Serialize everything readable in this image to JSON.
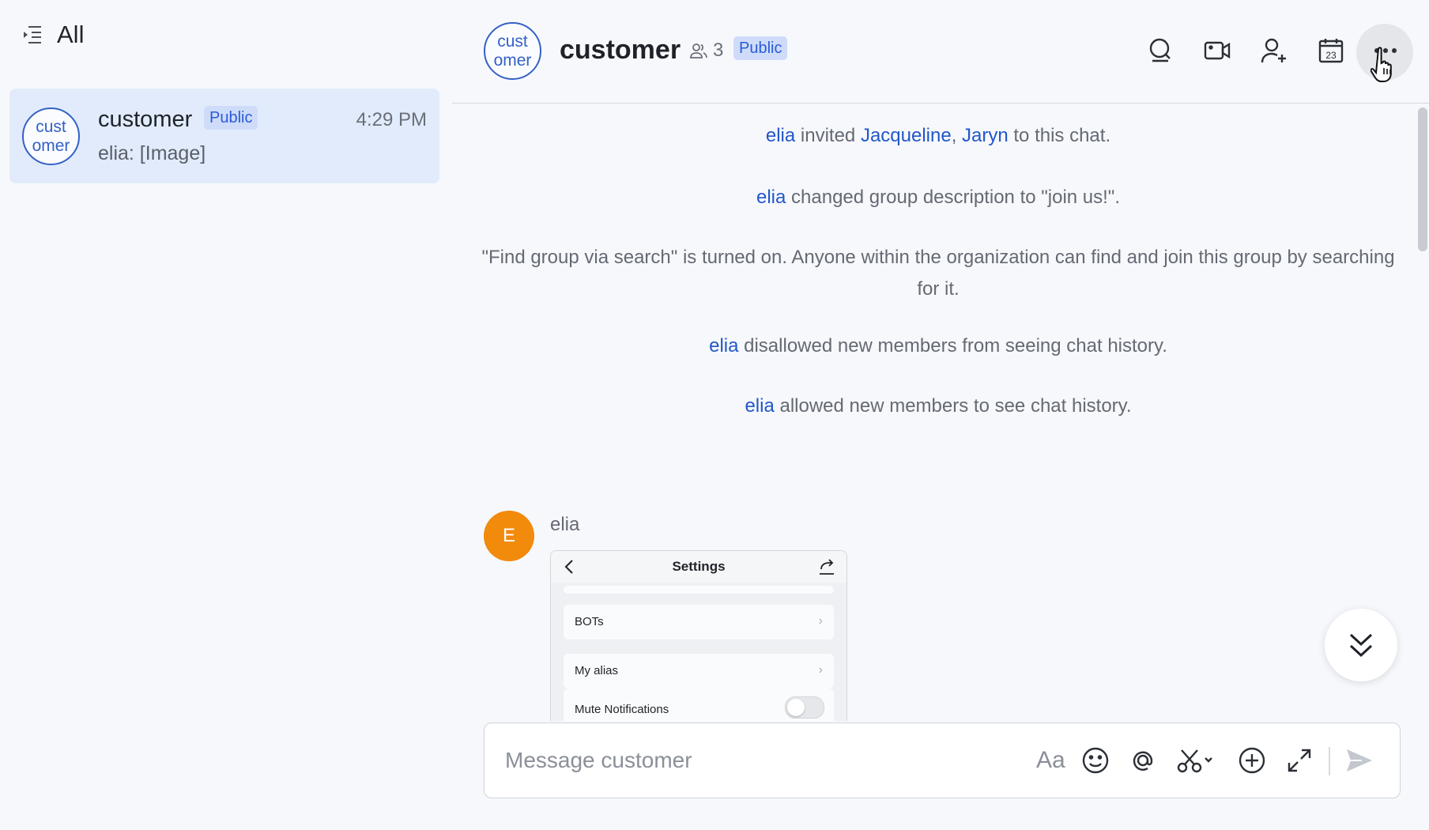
{
  "sidebar": {
    "title": "All",
    "chat_item": {
      "avatar_text_line1": "cust",
      "avatar_text_line2": "omer",
      "name": "customer",
      "tag": "Public",
      "time": "4:29 PM",
      "preview": "elia: [Image]"
    }
  },
  "header": {
    "avatar_text_line1": "cust",
    "avatar_text_line2": "omer",
    "name": "customer",
    "member_count": "3",
    "tag": "Public",
    "icons": [
      "search-icon",
      "video-call-icon",
      "add-member-icon",
      "calendar-icon",
      "more-icon"
    ],
    "calendar_day": "23"
  },
  "messages": {
    "system": [
      {
        "actor": "elia",
        "text1": " invited ",
        "link1": "Jacqueline",
        "sep": ", ",
        "link2": "Jaryn",
        "text2": " to this chat."
      },
      {
        "actor": "elia",
        "text": " changed group description to \"join us!\"."
      },
      {
        "text_line1": "\"Find group via search\" is turned on. Anyone within the organization can find and join this group by searching",
        "text_line2": "for it."
      },
      {
        "actor": "elia",
        "text": " disallowed new members from seeing chat history."
      },
      {
        "actor": "elia",
        "text": " allowed new members to see chat history."
      }
    ],
    "image_message": {
      "sender": "elia",
      "avatar_letter": "E",
      "screenshot": {
        "title": "Settings",
        "rows": [
          "BOTs",
          "My alias",
          "Mute Notifications"
        ]
      }
    }
  },
  "composer": {
    "placeholder": "Message customer",
    "format_icon_text": "Aa",
    "icons": [
      "text-format-icon",
      "emoji-icon",
      "mention-icon",
      "screenshot-icon",
      "add-icon",
      "expand-icon",
      "send-icon"
    ]
  },
  "colors": {
    "accent": "#2157c9",
    "selected_item_bg": "#e1ebfb",
    "public_tag_bg": "#cfdcf9",
    "avatar_orange": "#f28a0c"
  }
}
